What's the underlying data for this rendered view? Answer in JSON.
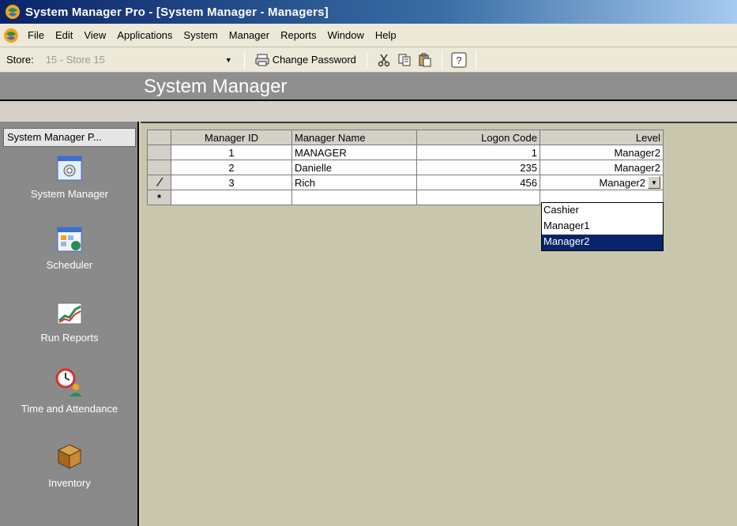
{
  "window": {
    "title": "System Manager Pro - [System Manager - Managers]"
  },
  "menu": {
    "items": [
      "File",
      "Edit",
      "View",
      "Applications",
      "System",
      "Manager",
      "Reports",
      "Window",
      "Help"
    ]
  },
  "toolbar": {
    "store_label": "Store:",
    "store_value": "15 - Store 15",
    "change_password_label": "Change Password",
    "icons": [
      "cut-icon",
      "copy-icon",
      "paste-icon",
      "help-icon"
    ]
  },
  "header": {
    "title": "System Manager"
  },
  "sidebar": {
    "header": "System Manager P...",
    "items": [
      {
        "label": "System Manager",
        "icon": "system-manager-icon"
      },
      {
        "label": "Scheduler",
        "icon": "scheduler-icon"
      },
      {
        "label": "Run Reports",
        "icon": "reports-chart-icon"
      },
      {
        "label": "Time and Attendance",
        "icon": "clock-person-icon"
      },
      {
        "label": "Inventory",
        "icon": "boxes-icon"
      }
    ]
  },
  "grid": {
    "columns": [
      "Manager ID",
      "Manager Name",
      "Logon Code",
      "Level"
    ],
    "rows": [
      {
        "id": "1",
        "name": "MANAGER",
        "logon": "1",
        "level": "Manager2"
      },
      {
        "id": "2",
        "name": "Danielle",
        "logon": "235",
        "level": "Manager2"
      },
      {
        "id": "3",
        "name": "Rich",
        "logon": "456",
        "level": "Manager2"
      }
    ],
    "new_row_marker": "*",
    "edit_marker": "pencil-icon"
  },
  "level_dropdown": {
    "options": [
      "Cashier",
      "Manager1",
      "Manager2"
    ],
    "selected": "Manager2"
  },
  "colors": {
    "selection": "#0a246a",
    "main_bg": "#c8c6ad",
    "sidebar_bg": "#8a8a8a"
  }
}
